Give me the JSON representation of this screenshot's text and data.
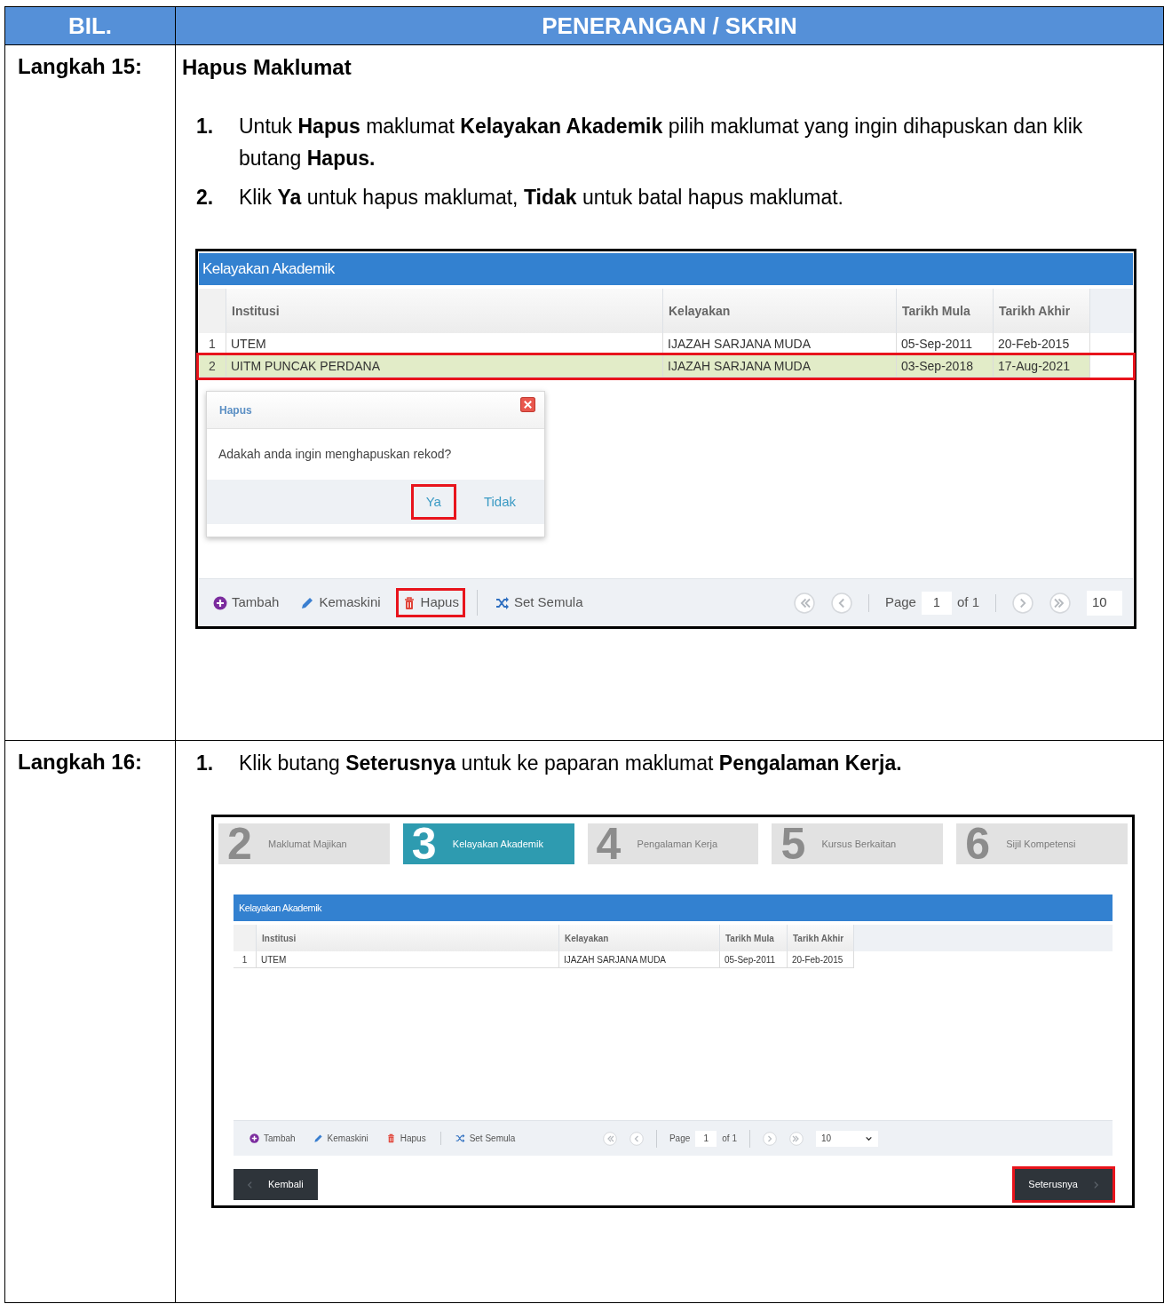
{
  "header": [
    "BIL.",
    "PENERANGAN / SKRIN"
  ],
  "steps": [
    {
      "label": "Langkah 15:",
      "title": "Hapus Maklumat",
      "instructions": [
        {
          "number": "1.",
          "text": "Untuk **Hapus** maklumat **Kelayakan Akademik** pilih maklumat yang ingin dihapuskan dan klik butang **Hapus.**"
        },
        {
          "number": "2.",
          "text": "Klik **Ya** untuk hapus maklumat, **Tidak** untuk batal hapus maklumat."
        }
      ],
      "screenshot": {
        "kind": "grid_dialog",
        "grid": {
          "title": "Kelayakan Akademik",
          "columns": [
            "Institusi",
            "Kelayakan",
            "Tarikh Mula",
            "Tarikh Akhir"
          ],
          "rows": [
            {
              "number": "1",
              "cells": [
                "UTEM",
                "IJAZAH SARJANA MUDA",
                "05-Sep-2011",
                "20-Feb-2015"
              ],
              "selected": false,
              "highlighted": false
            },
            {
              "number": "2",
              "cells": [
                "UITM PUNCAK PERDANA",
                "IJAZAH SARJANA MUDA",
                "03-Sep-2018",
                "17-Aug-2021"
              ],
              "selected": true,
              "highlighted": true
            }
          ],
          "toolbar": [
            {
              "kind": "add",
              "label": "Tambah",
              "highlighted": false
            },
            {
              "kind": "edit",
              "label": "Kemaskini",
              "highlighted": false
            },
            {
              "kind": "delete",
              "label": "Hapus",
              "highlighted": true
            },
            {
              "kind": "reset",
              "label": "Set Semula",
              "highlighted": false
            }
          ],
          "pager": {
            "label": "Page",
            "page": "1",
            "total": "of 1",
            "page_size": "10"
          }
        },
        "dialog": {
          "title": "Hapus",
          "message": "Adakah anda ingin menghapuskan rekod?",
          "buttons": [
            {
              "label": "Ya",
              "highlighted": true
            },
            {
              "label": "Tidak",
              "highlighted": false
            }
          ]
        }
      }
    },
    {
      "label": "Langkah 16:",
      "instructions": [
        {
          "number": "1.",
          "text": "Klik butang **Seterusnya** untuk ke paparan maklumat **Pengalaman Kerja.**"
        }
      ],
      "screenshot": {
        "kind": "wizard",
        "wizard_steps": [
          {
            "number": "2",
            "label": "Maklumat Majikan",
            "selected": false
          },
          {
            "number": "3",
            "label": "Kelayakan Akademik",
            "selected": true
          },
          {
            "number": "4",
            "label": "Pengalaman Kerja",
            "selected": false
          },
          {
            "number": "5",
            "label": "Kursus Berkaitan",
            "selected": false
          },
          {
            "number": "6",
            "label": "Sijil Kompetensi",
            "selected": false
          }
        ],
        "grid": {
          "title": "Kelayakan Akademik",
          "columns": [
            "Institusi",
            "Kelayakan",
            "Tarikh Mula",
            "Tarikh Akhir"
          ],
          "rows": [
            {
              "number": "1",
              "cells": [
                "UTEM",
                "IJAZAH SARJANA MUDA",
                "05-Sep-2011",
                "20-Feb-2015"
              ],
              "selected": false,
              "highlighted": false
            }
          ],
          "toolbar": [
            {
              "kind": "add",
              "label": "Tambah",
              "highlighted": false
            },
            {
              "kind": "edit",
              "label": "Kemaskini",
              "highlighted": false
            },
            {
              "kind": "delete",
              "label": "Hapus",
              "highlighted": false
            },
            {
              "kind": "reset",
              "label": "Set Semula",
              "highlighted": false
            }
          ],
          "pager": {
            "label": "Page",
            "page": "1",
            "total": "of 1",
            "page_size": "10"
          }
        },
        "footer_buttons": [
          {
            "kind": "back",
            "label": "Kembali",
            "highlighted": false
          },
          {
            "kind": "next",
            "label": "Seterusnya",
            "highlighted": true
          }
        ]
      }
    }
  ]
}
